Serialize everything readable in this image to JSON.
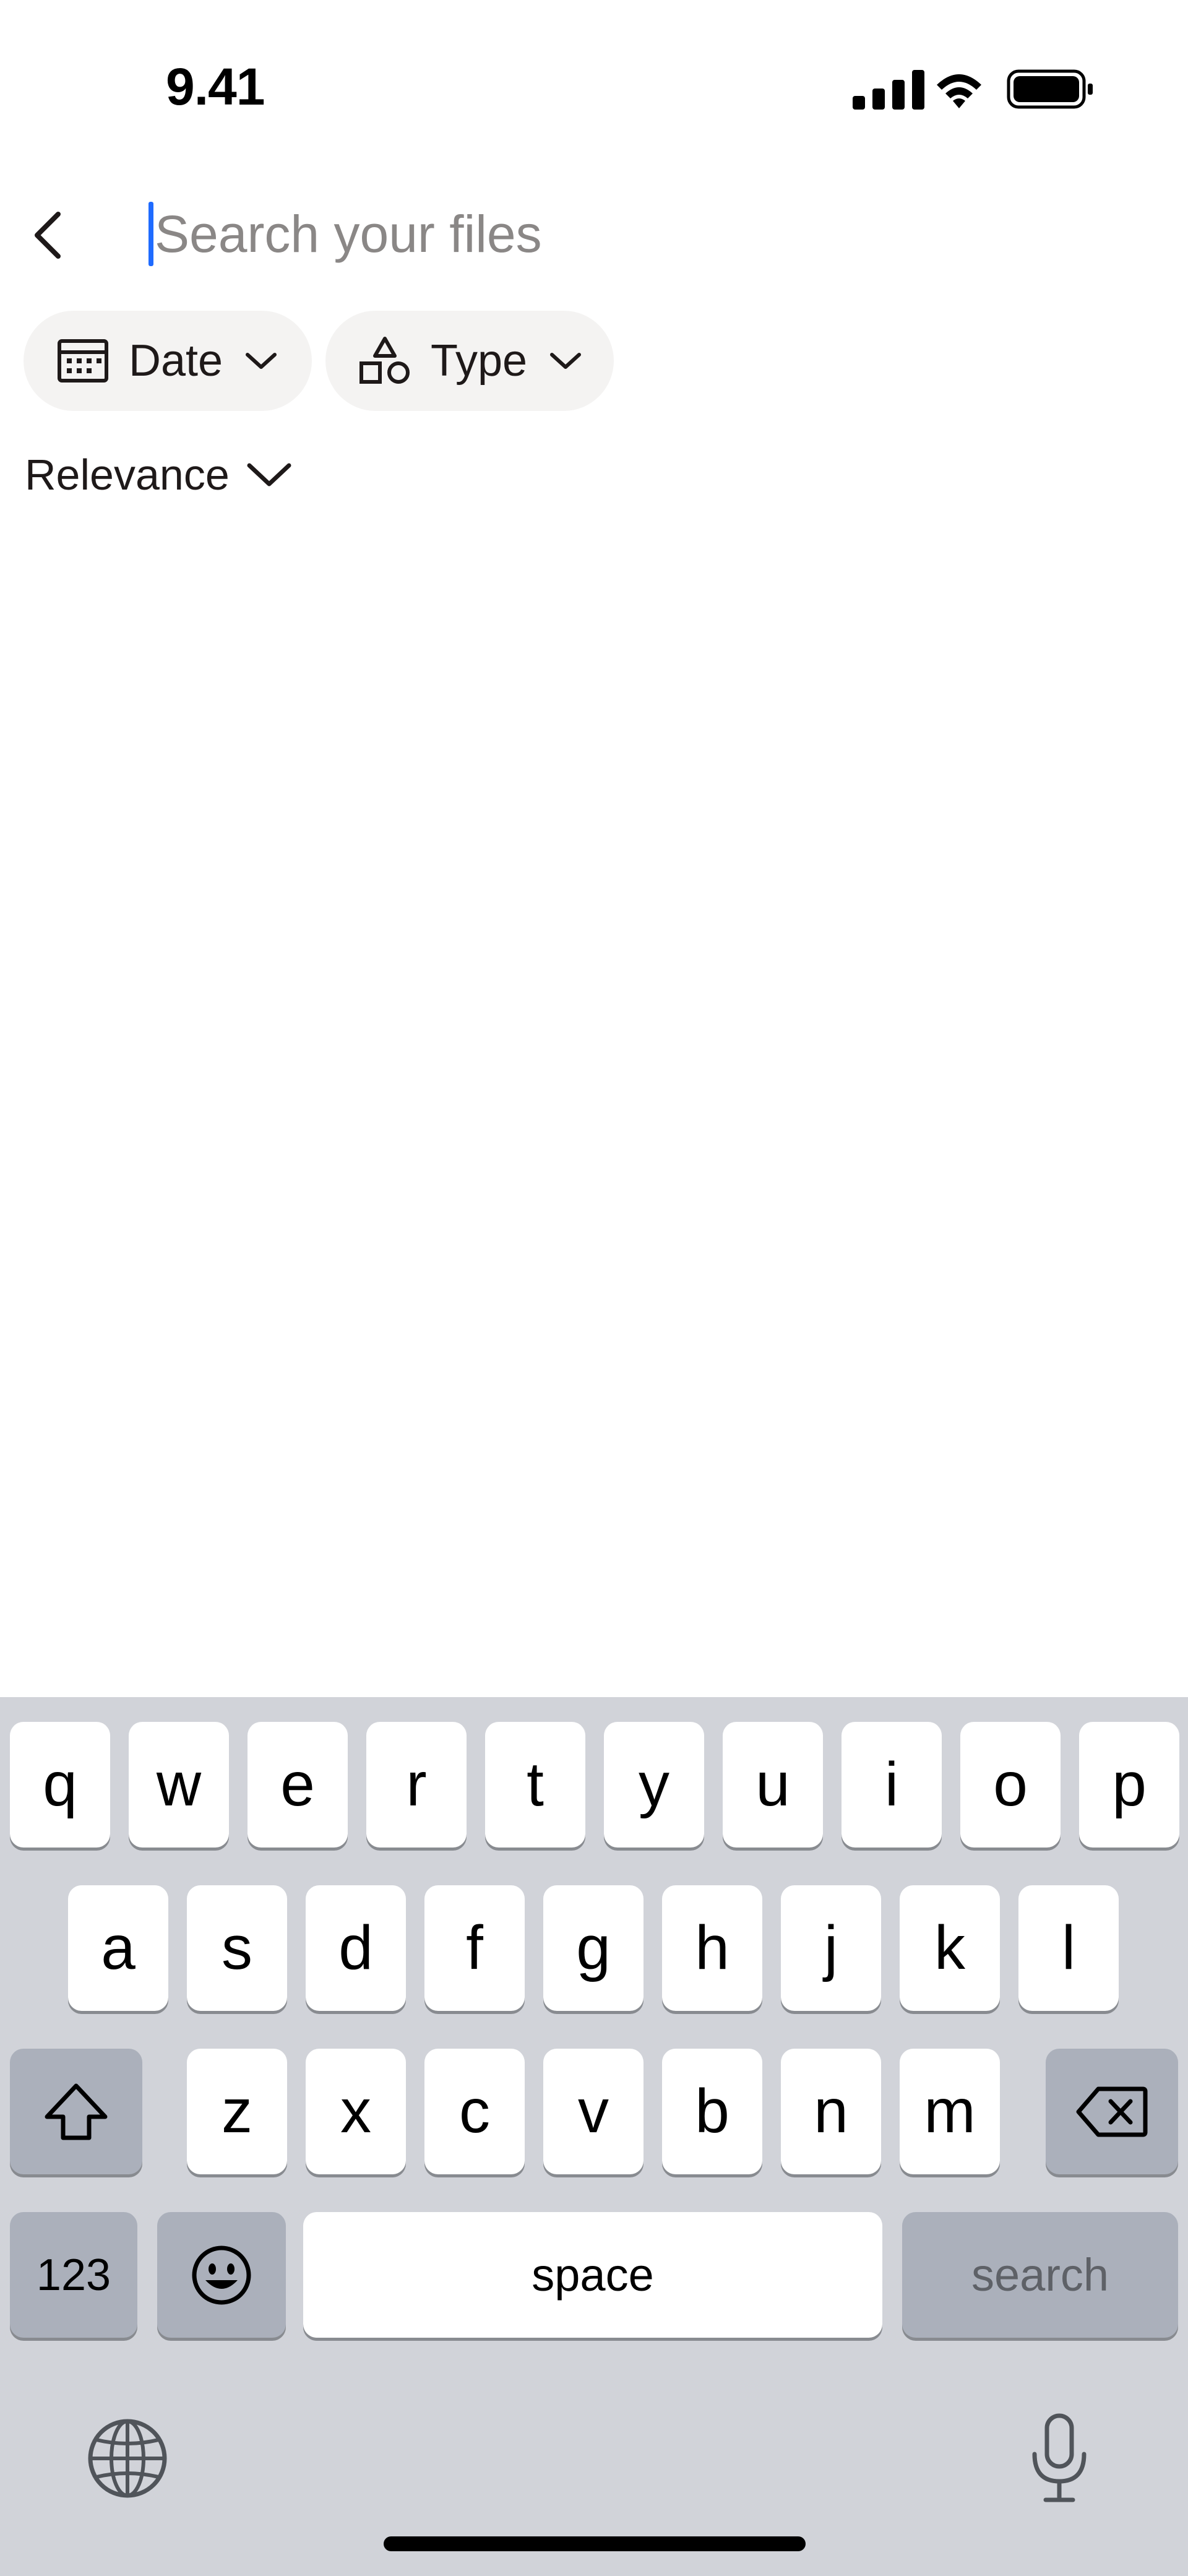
{
  "status_bar": {
    "time": "9.41"
  },
  "search": {
    "placeholder": "Search your files",
    "value": ""
  },
  "filters": {
    "date_label": "Date",
    "type_label": "Type"
  },
  "sort": {
    "label": "Relevance"
  },
  "keyboard": {
    "row1": [
      "q",
      "w",
      "e",
      "r",
      "t",
      "y",
      "u",
      "i",
      "o",
      "p"
    ],
    "row2": [
      "a",
      "s",
      "d",
      "f",
      "g",
      "h",
      "j",
      "k",
      "l"
    ],
    "row3": [
      "z",
      "x",
      "c",
      "v",
      "b",
      "n",
      "m"
    ],
    "numbers_label": "123",
    "space_label": "space",
    "return_label": "search"
  },
  "colors": {
    "caret": "#1f6bff",
    "chip_bg": "#f4f3f2",
    "keyboard_bg": "#d1d3d9"
  }
}
